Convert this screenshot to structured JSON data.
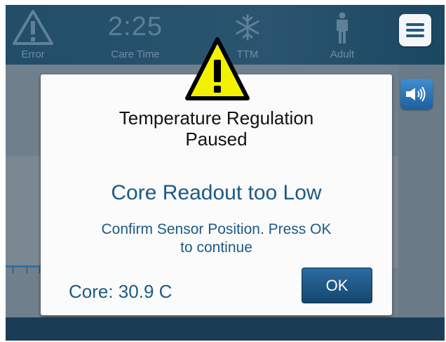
{
  "status_bar": {
    "error_label": "Error",
    "care_time_value": "2:25",
    "care_time_label": "Care Time",
    "ttm_label": "TTM",
    "patient_label": "Adult",
    "icons": {
      "error": "warning-triangle-icon",
      "ttm": "snowflake-icon",
      "patient": "person-icon",
      "menu": "hamburger-menu-icon"
    }
  },
  "side_panel": {
    "sound_icon": "speaker-icon"
  },
  "dialog": {
    "icon": "warning-triangle-icon",
    "title_line1": "Temperature Regulation",
    "title_line2": "Paused",
    "message": "Core Readout too Low",
    "instruction_line1": "Confirm Sensor Position. Press OK",
    "instruction_line2": "to continue",
    "core_reading": "Core: 30.9 C",
    "ok_label": "OK"
  },
  "colors": {
    "header": "#1d4a66",
    "dialog_text": "#1c5a86",
    "warning_yellow": "#f2f200",
    "ok_button": "#1f5a8a"
  }
}
